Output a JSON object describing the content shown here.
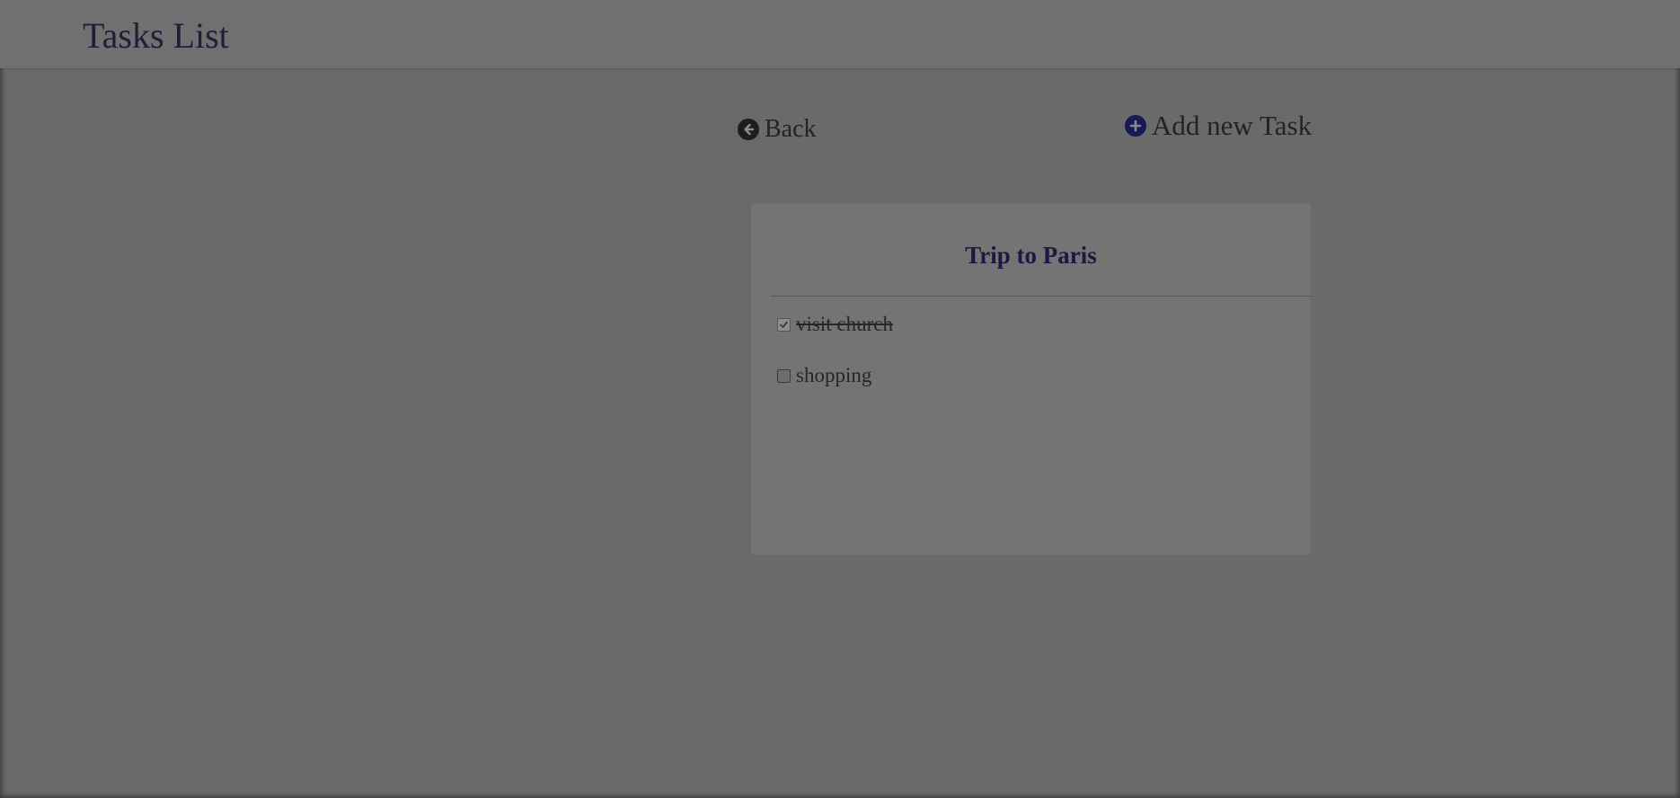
{
  "header": {
    "title": "Tasks List"
  },
  "nav": {
    "back_label": "Back",
    "add_label": "Add new Task"
  },
  "card": {
    "title": "Trip to Paris",
    "tasks": [
      {
        "label": "visit church",
        "checked": true
      },
      {
        "label": "shopping",
        "checked": false
      }
    ]
  },
  "colors": {
    "title_accent": "#1a1a40",
    "add_icon": "#16185a",
    "overlay": "#6a6a6a"
  },
  "icons": {
    "back": "arrow-left-circle-icon",
    "add": "plus-circle-icon",
    "check": "check-icon"
  }
}
